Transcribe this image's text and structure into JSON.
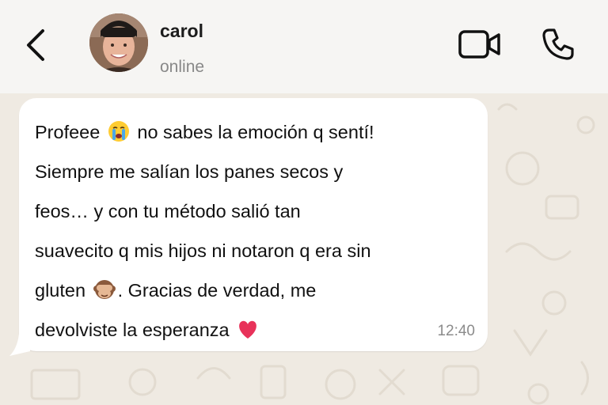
{
  "header": {
    "contact_name": "carol",
    "status": "online"
  },
  "icons": {
    "back": "chevron-left-icon",
    "video": "video-camera-icon",
    "phone": "phone-icon"
  },
  "message": {
    "line1_a": "Profeee",
    "line1_b": "no sabes la emoción q sentí!",
    "line2": "Siempre me salían los panes secos y",
    "line3": "feos… y con tu método salió tan",
    "line4": "suavecito q mis hijos ni notaron q era sin",
    "line5_a": "gluten",
    "line5_b": ". Gracias de verdad, me",
    "line6": "devolviste la esperanza",
    "time": "12:40",
    "emojis": [
      "crying-face-emoji",
      "see-no-evil-monkey-emoji",
      "red-heart-emoji"
    ]
  },
  "colors": {
    "header_bg": "#f6f5f3",
    "chat_bg": "#efeae2",
    "bubble_bg": "#ffffff"
  }
}
